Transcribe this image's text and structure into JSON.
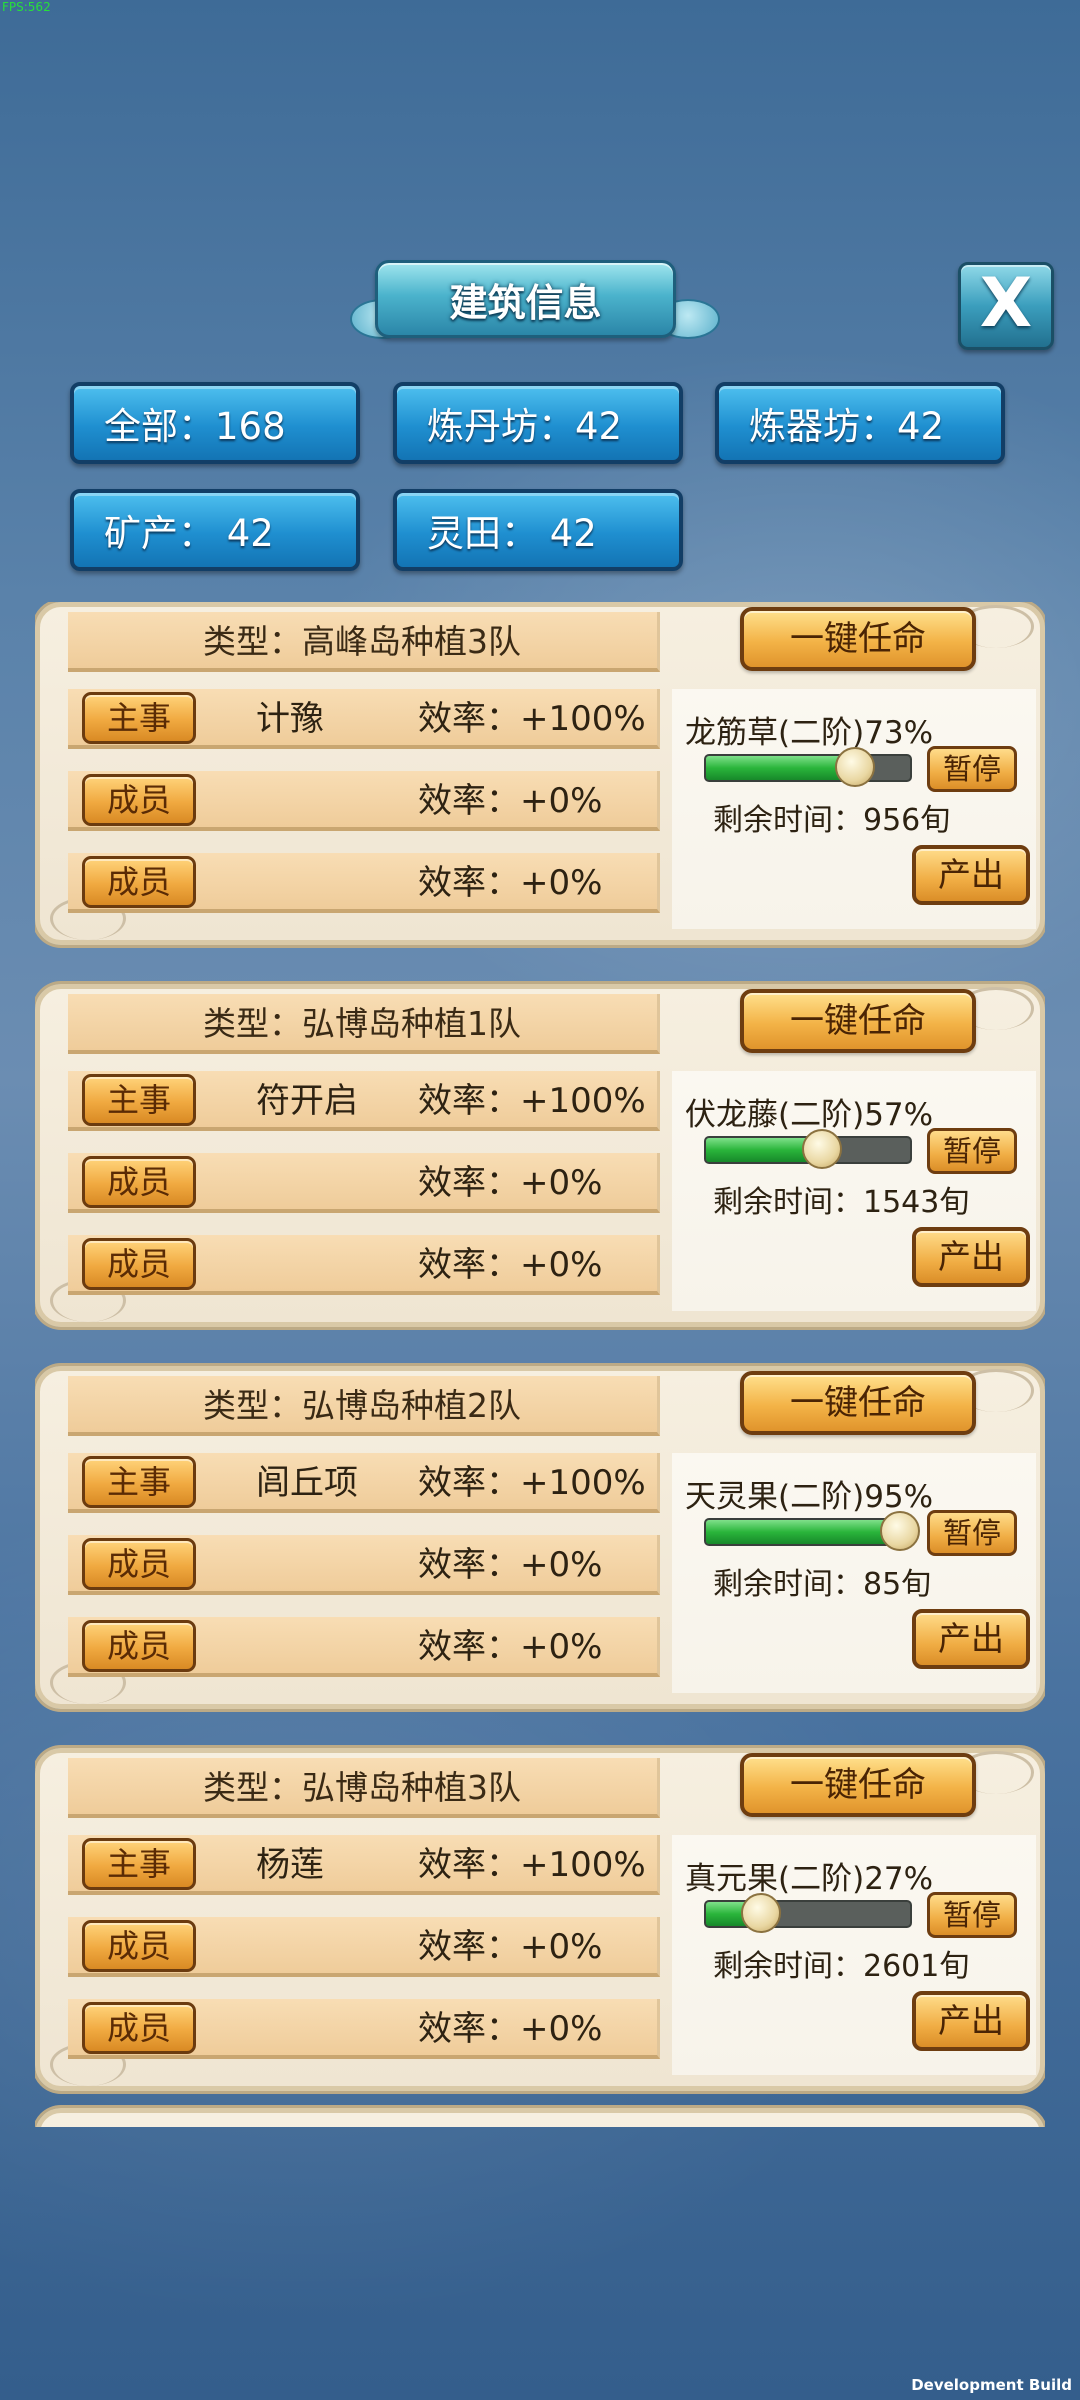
{
  "debug": {
    "fps": "FPS:562",
    "build": "Development Build"
  },
  "header": {
    "title": "建筑信息",
    "close_label": "X"
  },
  "tabs": [
    {
      "label": "全部：168"
    },
    {
      "label": "炼丹坊：42"
    },
    {
      "label": "炼器坊：42"
    },
    {
      "label": "矿产： 42"
    },
    {
      "label": "灵田： 42"
    }
  ],
  "buttons": {
    "appoint": "一键任命",
    "pause": "暂停",
    "output": "产出"
  },
  "teams": [
    {
      "type": "类型：高峰岛种植3队",
      "rows": [
        {
          "role": "主事",
          "name": "计豫",
          "efficiency": "效率：+100%"
        },
        {
          "role": "成员",
          "name": "",
          "efficiency": "效率：+0%"
        },
        {
          "role": "成员",
          "name": "",
          "efficiency": "效率：+0%"
        }
      ],
      "herb": "龙筋草(二阶)73%",
      "progress": 0.73,
      "remaining": "剩余时间：956旬"
    },
    {
      "type": "类型：弘博岛种植1队",
      "rows": [
        {
          "role": "主事",
          "name": "符开启",
          "efficiency": "效率：+100%"
        },
        {
          "role": "成员",
          "name": "",
          "efficiency": "效率：+0%"
        },
        {
          "role": "成员",
          "name": "",
          "efficiency": "效率：+0%"
        }
      ],
      "herb": "伏龙藤(二阶)57%",
      "progress": 0.57,
      "remaining": "剩余时间：1543旬"
    },
    {
      "type": "类型：弘博岛种植2队",
      "rows": [
        {
          "role": "主事",
          "name": "闾丘项",
          "efficiency": "效率：+100%"
        },
        {
          "role": "成员",
          "name": "",
          "efficiency": "效率：+0%"
        },
        {
          "role": "成员",
          "name": "",
          "efficiency": "效率：+0%"
        }
      ],
      "herb": "天灵果(二阶)95%",
      "progress": 0.95,
      "remaining": "剩余时间：85旬"
    },
    {
      "type": "类型：弘博岛种植3队",
      "rows": [
        {
          "role": "主事",
          "name": "杨莲",
          "efficiency": "效率：+100%"
        },
        {
          "role": "成员",
          "name": "",
          "efficiency": "效率：+0%"
        },
        {
          "role": "成员",
          "name": "",
          "efficiency": "效率：+0%"
        }
      ],
      "herb": "真元果(二阶)27%",
      "progress": 0.27,
      "remaining": "剩余时间：2601旬"
    }
  ]
}
